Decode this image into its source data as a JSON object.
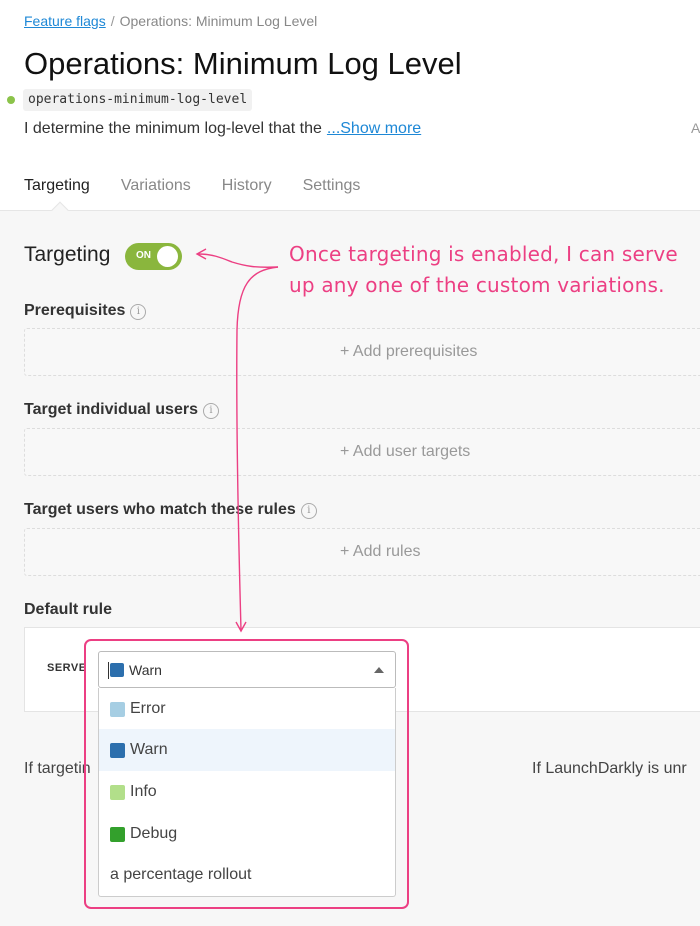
{
  "breadcrumb": {
    "parent": "Feature flags",
    "separator": "/",
    "current": "Operations: Minimum Log Level"
  },
  "flag": {
    "title": "Operations: Minimum Log Level",
    "key": "operations-minimum-log-level",
    "description": "I determine the minimum log-level that the",
    "show_more": "...Show more",
    "edge_text": "A",
    "status_color": "#8bc34a"
  },
  "tabs": [
    {
      "label": "Targeting",
      "active": true
    },
    {
      "label": "Variations",
      "active": false
    },
    {
      "label": "History",
      "active": false
    },
    {
      "label": "Settings",
      "active": false
    }
  ],
  "targeting": {
    "label": "Targeting",
    "toggle_text": "ON",
    "enabled": true,
    "toggle_color": "#8ab63d"
  },
  "sections": {
    "prerequisites": {
      "label": "Prerequisites",
      "info": "i",
      "add": "+ Add prerequisites"
    },
    "individual": {
      "label": "Target individual users",
      "info": "i",
      "add": "+ Add user targets"
    },
    "rules": {
      "label": "Target users who match these rules",
      "info": "i",
      "add": "+ Add rules"
    },
    "default_rule": {
      "label": "Default rule",
      "serve": "SERVE"
    }
  },
  "select": {
    "value": "Warn",
    "value_color": "#2c6fad",
    "options": [
      {
        "label": "Error",
        "color": "#a6cee3",
        "selected": false
      },
      {
        "label": "Warn",
        "color": "#2c6fad",
        "selected": true
      },
      {
        "label": "Info",
        "color": "#b2df8a",
        "selected": false
      },
      {
        "label": "Debug",
        "color": "#33a02c",
        "selected": false
      },
      {
        "label": "a percentage rollout",
        "color": null,
        "selected": false
      }
    ]
  },
  "footer": {
    "left": "If targetin",
    "right": "If LaunchDarkly is unr"
  },
  "annotation": {
    "line1": "Once targeting is enabled, I can serve",
    "line2": "up any one of the custom variations.",
    "color": "#ec3f83"
  }
}
